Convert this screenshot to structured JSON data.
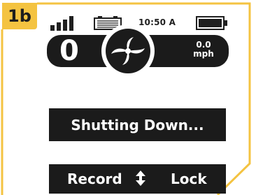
{
  "badge": {
    "label": "1b"
  },
  "status_bar": {
    "signal_icon": "signal-bars-icon",
    "device_battery_icon": "device-battery-icon",
    "time": "10:50 A",
    "battery_icon": "battery-icon"
  },
  "speed_panel": {
    "count": "0",
    "mode_icon": "fan-mode-icon",
    "speed_value": "0.0",
    "speed_unit": "mph"
  },
  "status_message": "Shutting Down...",
  "bottom_bar": {
    "record_label": "Record",
    "arrows_icon": "up-down-arrow-icon",
    "lock_label": "Lock"
  },
  "colors": {
    "accent": "#f4c341",
    "panel": "#1b1b1b",
    "text_light": "#ffffff"
  }
}
